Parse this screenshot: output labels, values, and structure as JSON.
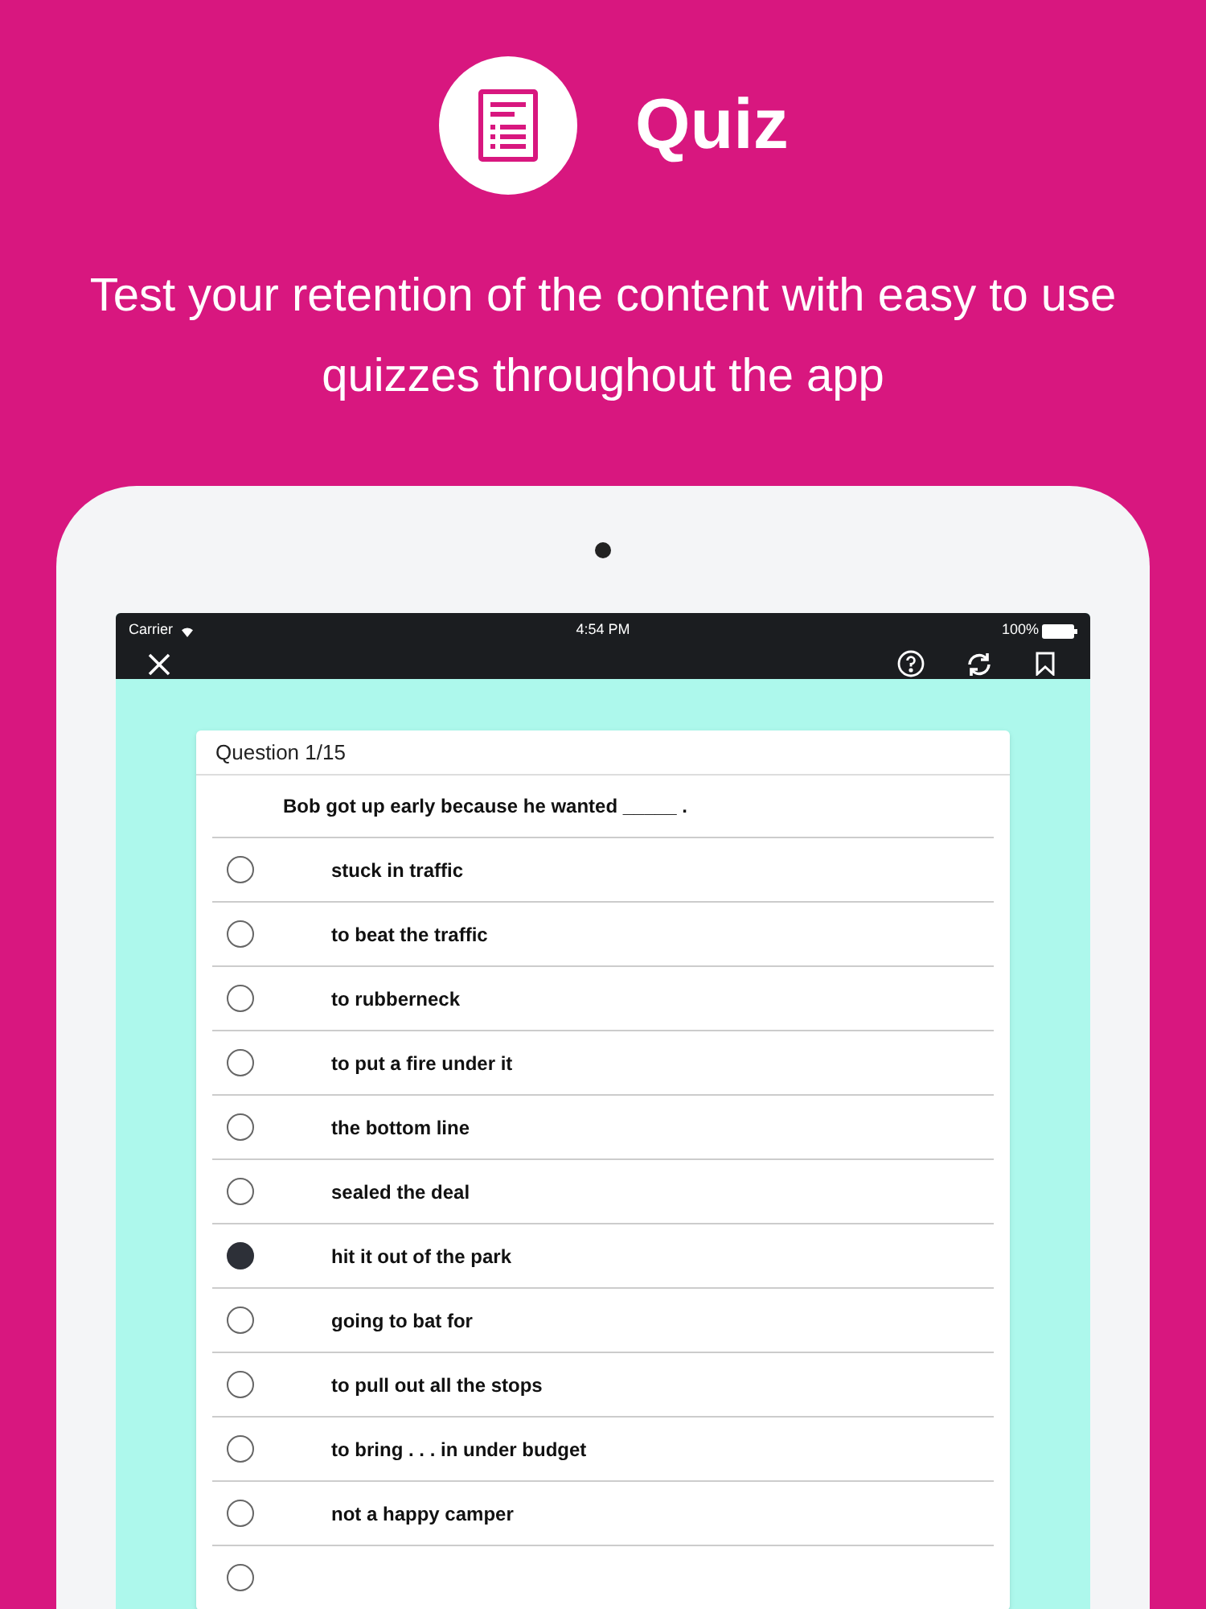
{
  "header": {
    "title": "Quiz",
    "subtitle": "Test your retention of the content with easy to use quizzes throughout the app"
  },
  "status_bar": {
    "carrier": "Carrier",
    "time": "4:54 PM",
    "battery": "100%"
  },
  "quiz": {
    "counter": "Question 1/15",
    "question": "Bob got up early because he wanted _____ .",
    "options": [
      {
        "label": "stuck in traffic",
        "selected": false
      },
      {
        "label": "to beat the traffic",
        "selected": false
      },
      {
        "label": "to rubberneck",
        "selected": false
      },
      {
        "label": "to put a fire under it",
        "selected": false
      },
      {
        "label": "the bottom line",
        "selected": false
      },
      {
        "label": "sealed the deal",
        "selected": false
      },
      {
        "label": "hit it out of the park",
        "selected": true
      },
      {
        "label": "going to bat for",
        "selected": false
      },
      {
        "label": "to pull out all the stops",
        "selected": false
      },
      {
        "label": "to bring . . . in under budget",
        "selected": false
      },
      {
        "label": "not a happy camper",
        "selected": false
      },
      {
        "selected": false
      }
    ]
  }
}
